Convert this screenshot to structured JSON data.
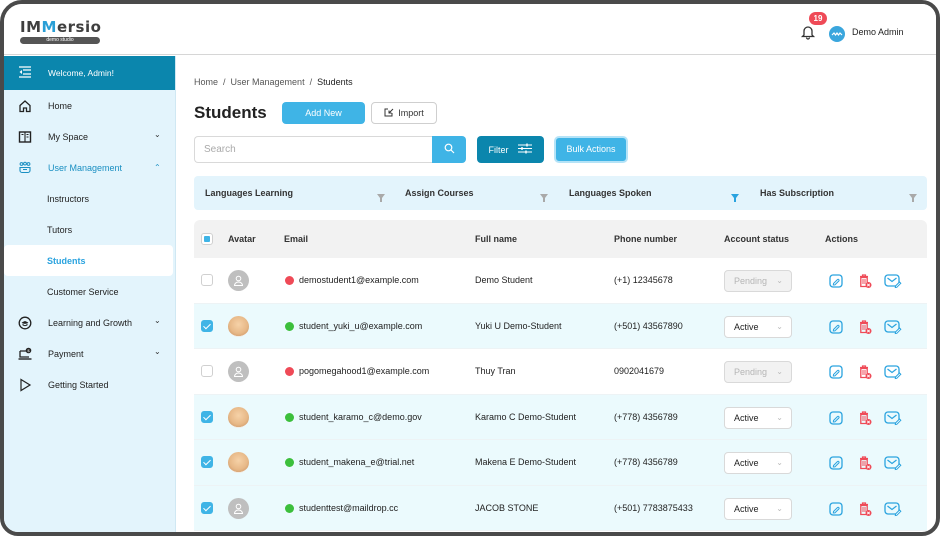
{
  "brand": {
    "name_prefix": "IM",
    "name_mid": "M",
    "name_suffix": "ersio",
    "tagline": "demo studio"
  },
  "topbar": {
    "notifications_count": "19",
    "user_name": "Demo Admin"
  },
  "sidebar": {
    "welcome": "Welcome, Admin!",
    "items": [
      {
        "label": "Home",
        "icon": "home-icon"
      },
      {
        "label": "My Space",
        "icon": "book-icon",
        "chevron": "down"
      },
      {
        "label": "User Management",
        "icon": "users-icon",
        "chevron": "up",
        "expanded": true
      },
      {
        "label": "Learning and Growth",
        "icon": "graduation-icon",
        "chevron": "down"
      },
      {
        "label": "Payment",
        "icon": "payment-icon",
        "chevron": "down"
      },
      {
        "label": "Getting Started",
        "icon": "play-icon"
      }
    ],
    "sub_items": [
      "Instructors",
      "Tutors",
      "Students",
      "Customer Service"
    ],
    "selected_sub": "Students"
  },
  "breadcrumb": [
    "Home",
    "User Management",
    "Students"
  ],
  "page": {
    "title": "Students",
    "add_new": "Add New",
    "import": "Import",
    "search_placeholder": "Search",
    "filter": "Filter",
    "bulk_actions": "Bulk Actions"
  },
  "filters": [
    "Languages Learning",
    "Assign Courses",
    "Languages Spoken",
    "Has Subscription"
  ],
  "active_filter": "Languages Spoken",
  "table": {
    "columns": [
      "Avatar",
      "Email",
      "Full name",
      "Phone number",
      "Account status",
      "Actions"
    ],
    "rows": [
      {
        "checked": false,
        "avatar": "placeholder",
        "verified": false,
        "email": "demostudent1@example.com",
        "name": "Demo Student",
        "phone": "(+1) 12345678",
        "status": "Pending"
      },
      {
        "checked": true,
        "avatar": "photo",
        "verified": true,
        "email": "student_yuki_u@example.com",
        "name": "Yuki U Demo-Student",
        "phone": "(+501) 43567890",
        "status": "Active"
      },
      {
        "checked": false,
        "avatar": "placeholder",
        "verified": false,
        "email": "pogomegahood1@example.com",
        "name": "Thuy Tran",
        "phone": "0902041679",
        "status": "Pending"
      },
      {
        "checked": true,
        "avatar": "photo",
        "verified": true,
        "email": "student_karamo_c@demo.gov",
        "name": "Karamo C Demo-Student",
        "phone": "(+778) 4356789",
        "status": "Active"
      },
      {
        "checked": true,
        "avatar": "photo",
        "verified": true,
        "email": "student_makena_e@trial.net",
        "name": "Makena E Demo-Student",
        "phone": "(+778) 4356789",
        "status": "Active"
      },
      {
        "checked": true,
        "avatar": "placeholder",
        "verified": true,
        "email": "studenttest@maildrop.cc",
        "name": "JACOB STONE",
        "phone": "(+501) 7783875433",
        "status": "Active"
      }
    ]
  },
  "colors": {
    "primary": "#0b86ad",
    "accent": "#3fb4e6",
    "danger": "#ef4a57",
    "success": "#3cbf3c",
    "sidebar_bg": "#e3f4fc"
  }
}
